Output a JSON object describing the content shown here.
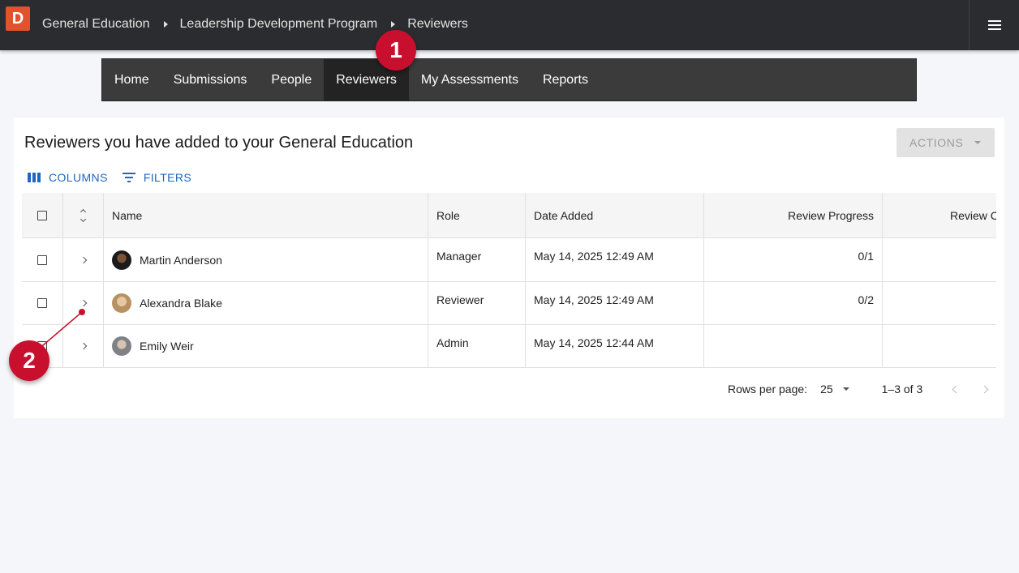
{
  "app": {
    "logo_letter": "D"
  },
  "breadcrumb": [
    "General Education",
    "Leadership Development Program",
    "Reviewers"
  ],
  "nav": {
    "tabs": [
      "Home",
      "Submissions",
      "People",
      "Reviewers",
      "My Assessments",
      "Reports"
    ],
    "active": "Reviewers"
  },
  "page": {
    "title": "Reviewers you have added to your General Education",
    "actions_label": "ACTIONS",
    "columns_label": "COLUMNS",
    "filters_label": "FILTERS"
  },
  "table": {
    "headers": [
      "Name",
      "Role",
      "Date Added",
      "Review Progress",
      "Review C"
    ],
    "rows": [
      {
        "name": "Martin Anderson",
        "role": "Manager",
        "date_added": "May 14, 2025 12:49 AM",
        "progress": "0/1"
      },
      {
        "name": "Alexandra Blake",
        "role": "Reviewer",
        "date_added": "May 14, 2025 12:49 AM",
        "progress": "0/2"
      },
      {
        "name": "Emily Weir",
        "role": "Admin",
        "date_added": "May 14, 2025 12:44 AM",
        "progress": ""
      }
    ]
  },
  "pagination": {
    "rows_per_page_label": "Rows per page:",
    "rows_per_page_value": "25",
    "range": "1–3 of 3"
  },
  "annotations": {
    "badge1": "1",
    "badge2": "2"
  },
  "colors": {
    "accent": "#1e66c0",
    "annotation": "#c8102e",
    "logo": "#e2532c",
    "topbar": "#2b2c2f"
  }
}
